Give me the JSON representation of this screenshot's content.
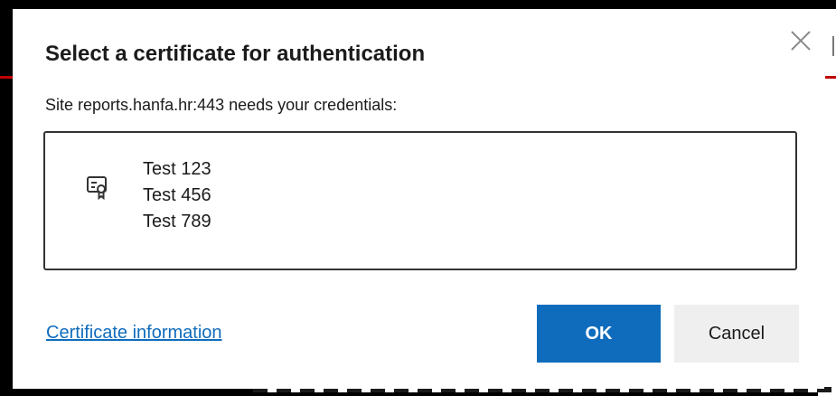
{
  "dialog": {
    "title": "Select a certificate for authentication",
    "subtitle": "Site reports.hanfa.hr:443 needs your credentials:",
    "certificates": [
      "Test 123",
      "Test 456",
      "Test 789"
    ],
    "certificate_icon": "certificate-icon",
    "close_icon": "close-icon",
    "info_link_label": "Certificate information",
    "ok_label": "OK",
    "cancel_label": "Cancel"
  },
  "colors": {
    "accent": "#0f6cbd",
    "cancel_bg": "#efefef",
    "backdrop": "#000000"
  }
}
